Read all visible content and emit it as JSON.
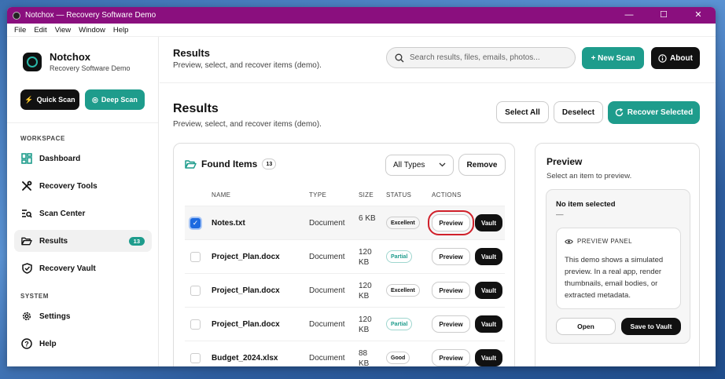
{
  "window": {
    "title": "Notchox — Recovery Software Demo",
    "minimize": "—",
    "maximize": "☐",
    "close": "✕"
  },
  "menu": [
    "File",
    "Edit",
    "View",
    "Window",
    "Help"
  ],
  "brand": {
    "name": "Notchox",
    "subtitle": "Recovery Software Demo"
  },
  "sidebar": {
    "quick_scan": "Quick Scan",
    "deep_scan": "Deep Scan",
    "workspace_label": "WORKSPACE",
    "system_label": "SYSTEM",
    "items": [
      {
        "label": "Dashboard",
        "icon": "dashboard-icon"
      },
      {
        "label": "Recovery Tools",
        "icon": "tools-icon"
      },
      {
        "label": "Scan Center",
        "icon": "scan-center-icon"
      },
      {
        "label": "Results",
        "icon": "folder-open-icon",
        "badge": "13",
        "active": true
      },
      {
        "label": "Recovery Vault",
        "icon": "shield-icon"
      }
    ],
    "system_items": [
      {
        "label": "Settings",
        "icon": "gear-icon"
      },
      {
        "label": "Help",
        "icon": "help-icon"
      }
    ]
  },
  "topbar": {
    "title": "Results",
    "subtitle": "Preview, select, and recover items (demo).",
    "search_placeholder": "Search results, files, emails, photos...",
    "new_scan": "+ New Scan",
    "about": "About"
  },
  "page": {
    "title": "Results",
    "subtitle": "Preview, select, and recover items (demo).",
    "select_all": "Select All",
    "deselect": "Deselect",
    "recover_selected": "Recover Selected"
  },
  "found": {
    "title": "Found Items",
    "count": "13",
    "filter_value": "All Types",
    "remove": "Remove",
    "columns": {
      "name": "NAME",
      "type": "TYPE",
      "size": "SIZE",
      "status": "STATUS",
      "actions": "ACTIONS"
    },
    "preview_label": "Preview",
    "vault_label": "Vault",
    "rows": [
      {
        "name": "Notes.txt",
        "type": "Document",
        "size": "6 KB",
        "status": "Excellent",
        "selected": true
      },
      {
        "name": "Project_Plan.docx",
        "type": "Document",
        "size": "120 KB",
        "status": "Partial",
        "selected": false
      },
      {
        "name": "Project_Plan.docx",
        "type": "Document",
        "size": "120 KB",
        "status": "Excellent",
        "selected": false
      },
      {
        "name": "Project_Plan.docx",
        "type": "Document",
        "size": "120 KB",
        "status": "Partial",
        "selected": false
      },
      {
        "name": "Budget_2024.xlsx",
        "type": "Document",
        "size": "88 KB",
        "status": "Good",
        "selected": false
      }
    ]
  },
  "preview": {
    "title": "Preview",
    "subtitle": "Select an item to preview.",
    "none_title": "No item selected",
    "none_dash": "—",
    "panel_head": "PREVIEW PANEL",
    "panel_text": "This demo shows a simulated preview. In a real app, render thumbnails, email bodies, or extracted metadata.",
    "open": "Open",
    "save_to_vault": "Save to Vault"
  },
  "colors": {
    "titlebar": "#8a0f7e",
    "accent": "#1e9c8c",
    "dark": "#111111",
    "checkbox": "#1d6ae0",
    "highlight": "#d0202a"
  }
}
